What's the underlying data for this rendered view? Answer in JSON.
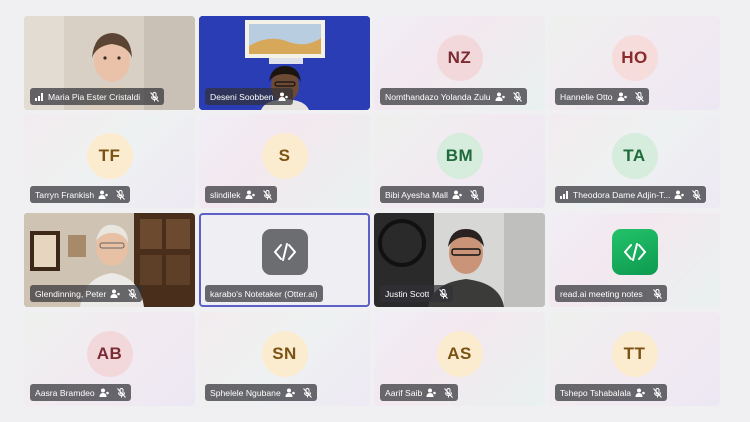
{
  "participants": [
    {
      "name": "Maria Pia Ester Cristaldi",
      "initials": "",
      "video": true,
      "signal": true,
      "muted": true
    },
    {
      "name": "Deseni Soobben",
      "initials": "",
      "video": true,
      "speaking": true,
      "spotlight": true
    },
    {
      "name": "Nomthandazo Yolanda Zulu",
      "initials": "NZ",
      "avatar_bg": "#f2d8da",
      "avatar_fg": "#7a2b33",
      "muted": true
    },
    {
      "name": "Hannelie Otto",
      "initials": "HO",
      "avatar_bg": "#f7dcdc",
      "avatar_fg": "#8a2a2a",
      "muted": true
    },
    {
      "name": "Tarryn Frankish",
      "initials": "TF",
      "avatar_bg": "#fbecd0",
      "avatar_fg": "#7a5212",
      "muted": true
    },
    {
      "name": "slindilek",
      "initials": "S",
      "avatar_bg": "#fbecd0",
      "avatar_fg": "#7a5212",
      "muted": true
    },
    {
      "name": "Bibi Ayesha Mall",
      "initials": "BM",
      "avatar_bg": "#d6ecdd",
      "avatar_fg": "#1f6b3a",
      "muted": true
    },
    {
      "name": "Theodora Dame Adjin-T...",
      "initials": "TA",
      "avatar_bg": "#d6ecdd",
      "avatar_fg": "#1f6b3a",
      "signal": true,
      "muted": true
    },
    {
      "name": "Glendinning, Peter",
      "initials": "",
      "video": true,
      "muted": true
    },
    {
      "name": "karabo's Notetaker (Otter.ai)",
      "initials": "",
      "app": "otter",
      "speaking": true
    },
    {
      "name": "Justin Scott",
      "initials": "",
      "video": true,
      "muted": true
    },
    {
      "name": "read.ai meeting notes",
      "initials": "",
      "app": "readai",
      "muted": true
    },
    {
      "name": "Aasra Bramdeo",
      "initials": "AB",
      "avatar_bg": "#f2d8da",
      "avatar_fg": "#7a2b33",
      "muted": true
    },
    {
      "name": "Sphelele Ngubane",
      "initials": "SN",
      "avatar_bg": "#fbecd0",
      "avatar_fg": "#7a5212",
      "muted": true
    },
    {
      "name": "Aarif Saib",
      "initials": "AS",
      "avatar_bg": "#fbecd0",
      "avatar_fg": "#7a5212",
      "muted": true
    },
    {
      "name": "Tshepo Tshabalala",
      "initials": "TT",
      "avatar_bg": "#fbecd0",
      "avatar_fg": "#7a5212",
      "muted": true
    }
  ],
  "colors": {
    "accent": "#5b5fc7",
    "namebar": "rgba(50,50,55,0.72)",
    "page_bg": "#f0f0f2"
  }
}
